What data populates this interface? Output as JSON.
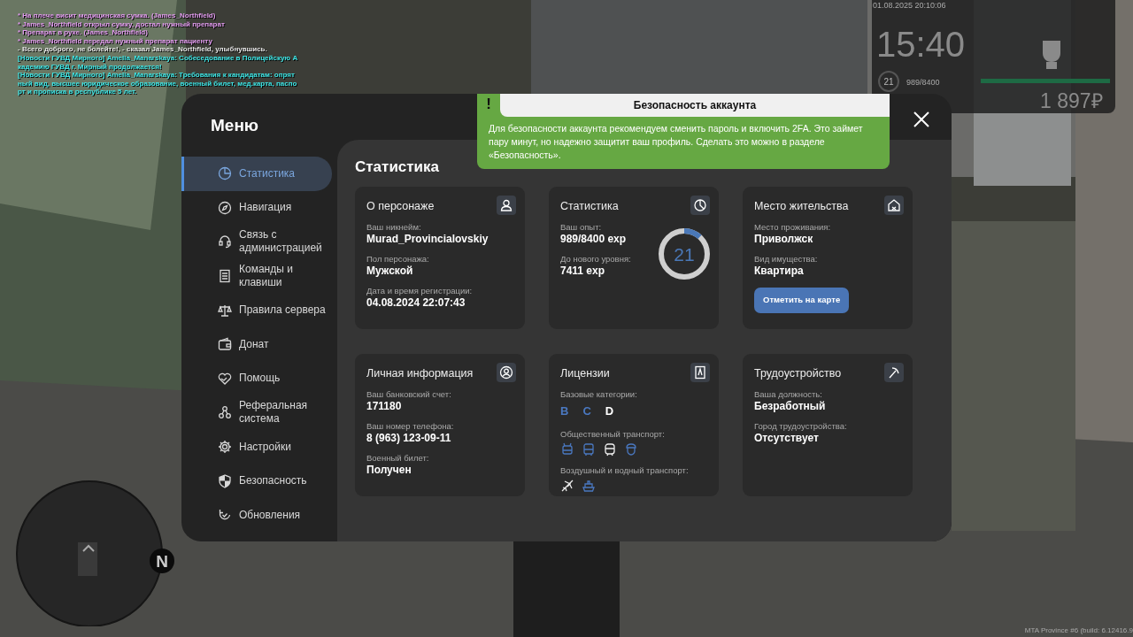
{
  "chat": [
    {
      "text": "* На плече висит медицинская сумка. (James_Northfield)",
      "color": "#e39cf0"
    },
    {
      "text": "* James_Northfield открыл сумку, достал нужный препарат",
      "color": "#e39cf0"
    },
    {
      "text": "* Препарат в руке. (James_Northfield)",
      "color": "#e39cf0"
    },
    {
      "text": "* James_Northfield передал нужный препарат пациенту",
      "color": "#e39cf0"
    },
    {
      "text": "- Всего доброго, не болейте!, - сказал James_Northfield, улыбнувшись.",
      "color": "#e6e6e6"
    },
    {
      "text": "[Новости ГУВД Мирного] Amelia_Manarskaya: Собеседование в Полицейскую А",
      "color": "#3ee6e6"
    },
    {
      "text": "кадемию ГУВД г. Мирный продолжается!",
      "color": "#3ee6e6"
    },
    {
      "text": "[Новости ГУВД Мирного] Amelia_Manarskaya: Требования к кандидатам: опрят",
      "color": "#3ee6e6"
    },
    {
      "text": "ный вид, высшее юридическое образование, военный билет, мед.карта, паспо",
      "color": "#3ee6e6"
    },
    {
      "text": "рт и прописка в республике 5 лет.",
      "color": "#3ee6e6"
    }
  ],
  "hud": {
    "datetime": "01.08.2025 20:10:06",
    "clock": "15:40",
    "level": "21",
    "exp": "989/8400",
    "health": {
      "level": 1
    },
    "money": "1 897₽"
  },
  "menu": {
    "title": "Меню",
    "sidebar": {
      "items": [
        {
          "label": "Статистика",
          "selected": true
        },
        {
          "label": "Навигация",
          "selected": false
        },
        {
          "label": "Связь с администрацией",
          "selected": false
        },
        {
          "label": "Команды и клавиши",
          "selected": false
        },
        {
          "label": "Правила сервера",
          "selected": false
        },
        {
          "label": "Донат",
          "selected": false
        },
        {
          "label": "Помощь",
          "selected": false
        },
        {
          "label": "Реферальная система",
          "selected": false
        },
        {
          "label": "Настройки",
          "selected": false
        },
        {
          "label": "Безопасность",
          "selected": false
        },
        {
          "label": "Обновления",
          "selected": false
        }
      ]
    },
    "heading": "Статистика",
    "cards": [
      {
        "kind": "info",
        "title": "О персонаже",
        "fields": [
          {
            "label": "Ваш никнейм:",
            "value": "Murad_Provincialovskiy"
          },
          {
            "label": "Пол персонажа:",
            "value": "Мужской"
          },
          {
            "label": "Дата и время регистрации:",
            "value": "04.08.2024 22:07:43"
          }
        ]
      },
      {
        "kind": "stats",
        "title": "Статистика",
        "fields": [
          {
            "label": "Ваш опыт:",
            "value": "989/8400 exp"
          },
          {
            "label": "До нового уровня:",
            "value": "7411 exp"
          }
        ],
        "ring": {
          "value": "21"
        }
      },
      {
        "kind": "info",
        "title": "Место жительства",
        "fields": [
          {
            "label": "Место проживания:",
            "value": "Приволжск"
          },
          {
            "label": "Вид имущества:",
            "value": "Квартира"
          }
        ],
        "button": "Отметить на карте"
      },
      {
        "kind": "info",
        "title": "Личная информация",
        "fields": [
          {
            "label": "Ваш банковский счет:",
            "value": "171180"
          },
          {
            "label": "Ваш номер телефона:",
            "value": "8 (963) 123-09-11"
          },
          {
            "label": "Военный билет:",
            "value": "Получен"
          }
        ]
      },
      {
        "kind": "licenses",
        "title": "Лицензии",
        "groups": [
          {
            "label": "Базовые категории:",
            "kind": "letters",
            "items": [
              {
                "text": "B",
                "active": true
              },
              {
                "text": "C",
                "active": true
              },
              {
                "text": "D",
                "active": false
              }
            ]
          },
          {
            "label": "Общественный транспорт:",
            "kind": "icons",
            "items": [
              {
                "active": true
              },
              {
                "active": true
              },
              {
                "active": false
              },
              {
                "active": true
              }
            ]
          },
          {
            "label": "Воздушный и водный транспорт:",
            "kind": "icons2",
            "items": [
              {
                "active": false
              },
              {
                "active": true
              }
            ]
          }
        ]
      },
      {
        "kind": "info",
        "title": "Трудоустройство",
        "fields": [
          {
            "label": "Ваша должность:",
            "value": "Безработный"
          },
          {
            "label": "Город трудоустройства:",
            "value": "Отсутствует"
          }
        ]
      }
    ]
  },
  "notification": {
    "title": "Безопасность аккаунта",
    "mark": "!",
    "text": "Для безопасности аккаунта рекомендуем сменить пароль и включить 2FA. Это займет пару минут, но надежно защитит ваш профиль. Сделать это можно в разделе «Безопасность»."
  },
  "minimap": {
    "north": "N"
  },
  "build": "MTA Province #6 (build: 6.12416.9"
}
